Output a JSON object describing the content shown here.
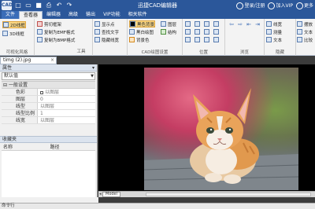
{
  "titlebar": {
    "app_icon": "CAD",
    "title": "迅捷CAD编辑器",
    "login": "登录/注册",
    "vip": "加入VIP",
    "more": "更多"
  },
  "menu_tabs": [
    "文件",
    "查看器",
    "编辑器",
    "高级",
    "输出",
    "VIP功能",
    "相关软件"
  ],
  "ribbon": {
    "view2d": "2D线框",
    "view3d": "3D线框",
    "visual_style_group": "可视化风格",
    "cut_frame": "剪切框架",
    "copy_emf": "复制为EMF格式",
    "copy_bmp": "复制为BMP格式",
    "tools_group": "工具",
    "show_points": "显示点",
    "find_text": "查找文字",
    "hide_lineweight": "隐藏线宽",
    "black_bg": "黑色背景",
    "bw_draw": "黑白绘图",
    "bg_color": "背景色",
    "layers": "图层",
    "structure": "结构",
    "cad_settings_group": "CAD绘图设置",
    "position_group": "位置",
    "browse_group": "浏览",
    "line_width": "线宽",
    "measure": "测量",
    "text": "文本",
    "hide_group": "隐藏",
    "arrange": "摆放",
    "text2": "文本",
    "compare": "比较"
  },
  "file_tab": "timg (2).jpg",
  "properties": {
    "header": "属性",
    "selected": "默认值",
    "category": "一般设置",
    "rows": [
      {
        "name": "色彩",
        "value": "以图层",
        "swatch": true
      },
      {
        "name": "图层",
        "value": "0"
      },
      {
        "name": "线型",
        "value": "以图层"
      },
      {
        "name": "线型比例",
        "value": "1"
      },
      {
        "name": "线宽",
        "value": "以图层"
      }
    ]
  },
  "favorites": {
    "header": "收藏夹",
    "col_name": "名称",
    "col_path": "路径"
  },
  "model_tab": "Model",
  "command_line": "命令行"
}
